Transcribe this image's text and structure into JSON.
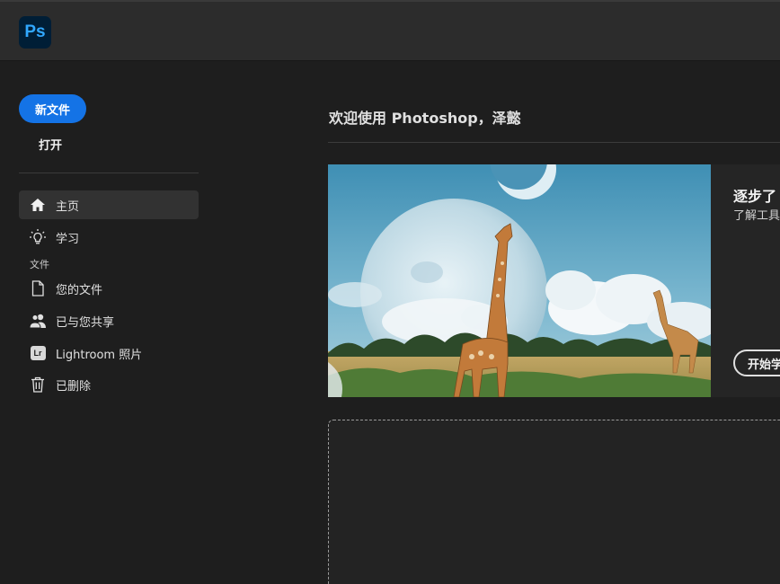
{
  "app": {
    "logo_text": "Ps"
  },
  "sidebar": {
    "new_file_label": "新文件",
    "open_label": "打开",
    "items": [
      {
        "label": "主页",
        "icon": "home-icon"
      },
      {
        "label": "学习",
        "icon": "lightbulb-icon"
      }
    ],
    "section_label": "文件",
    "file_items": [
      {
        "label": "您的文件",
        "icon": "document-icon"
      },
      {
        "label": "已与您共享",
        "icon": "users-icon"
      },
      {
        "label": "Lightroom 照片",
        "icon": "lightroom-icon",
        "badge": "Lr"
      },
      {
        "label": "已删除",
        "icon": "trash-icon"
      }
    ]
  },
  "main": {
    "welcome_text": "欢迎使用 Photoshop，泽懿",
    "hero": {
      "title": "逐步了",
      "subtitle": "了解工具",
      "button_label": "开始学"
    }
  },
  "colors": {
    "accent": "#1473e6",
    "background": "#1e1e1e",
    "topbar": "#2c2c2c",
    "ps_logo_bg": "#001e36",
    "ps_logo_fg": "#31a8ff"
  }
}
